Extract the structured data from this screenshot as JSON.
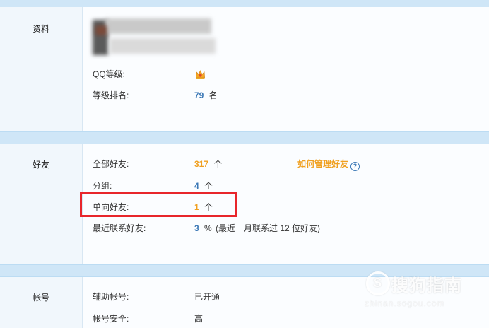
{
  "profile": {
    "section_title": "资料",
    "qq_level_label": "QQ等级:",
    "level_rank_label": "等级排名:",
    "level_rank_value": "79",
    "level_rank_unit": "名"
  },
  "friends": {
    "section_title": "好友",
    "rows": [
      {
        "label": "全部好友:",
        "value": "317",
        "unit": "个"
      },
      {
        "label": "分组:",
        "value": "4",
        "unit": "个"
      },
      {
        "label": "单向好友:",
        "value": "1",
        "unit": "个"
      },
      {
        "label": "最近联系好友:",
        "value": "3",
        "unit": "%",
        "note": "(最近一月联系过 12 位好友)"
      }
    ],
    "manage_link": "如何管理好友",
    "help_icon_glyph": "?"
  },
  "account": {
    "section_title": "帐号",
    "rows": [
      {
        "label": "辅助帐号:",
        "value": "已开通"
      },
      {
        "label": "帐号安全:",
        "value": "高"
      }
    ]
  },
  "watermark": {
    "logo_glyph": "S",
    "title": "搜狗指南",
    "url": "zhinan.sogou.com"
  },
  "colors": {
    "band": "#cfe6f7",
    "accent_blue": "#3b78b6",
    "accent_orange": "#f0a020",
    "highlight_red": "#e8262b"
  }
}
